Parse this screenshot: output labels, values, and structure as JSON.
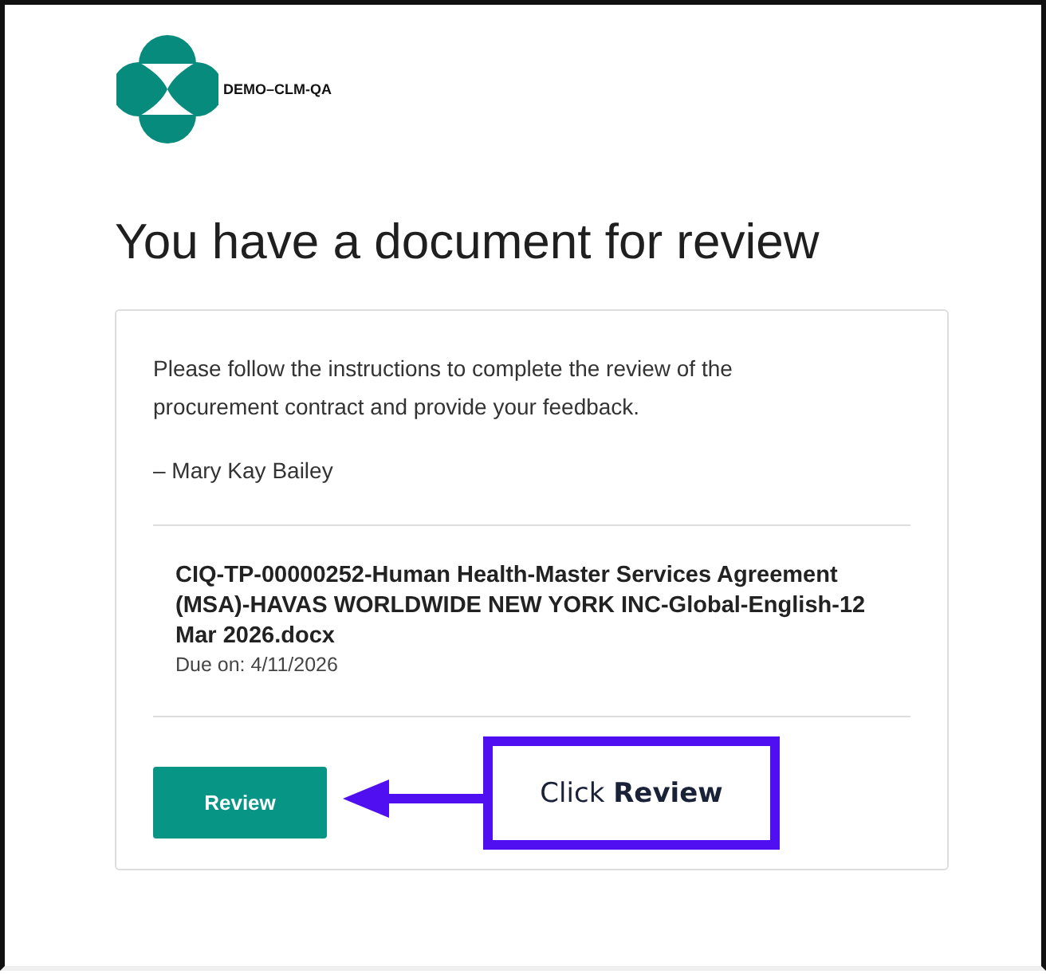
{
  "header": {
    "org_name": "DEMO–CLM-QA"
  },
  "heading": "You have a document for review",
  "card": {
    "message": "Please follow the instructions to complete the review of the procurement contract and provide your feedback.",
    "signature": "– Mary Kay Bailey",
    "document": {
      "name": "CIQ-TP-00000252-Human Health-Master Services Agreement (MSA)-HAVAS WORLDWIDE NEW YORK INC-Global-English-12 Mar 2026.docx",
      "due": "Due on: 4/11/2026"
    },
    "button": "Review"
  },
  "annotation": {
    "text": "Click **Review**"
  }
}
